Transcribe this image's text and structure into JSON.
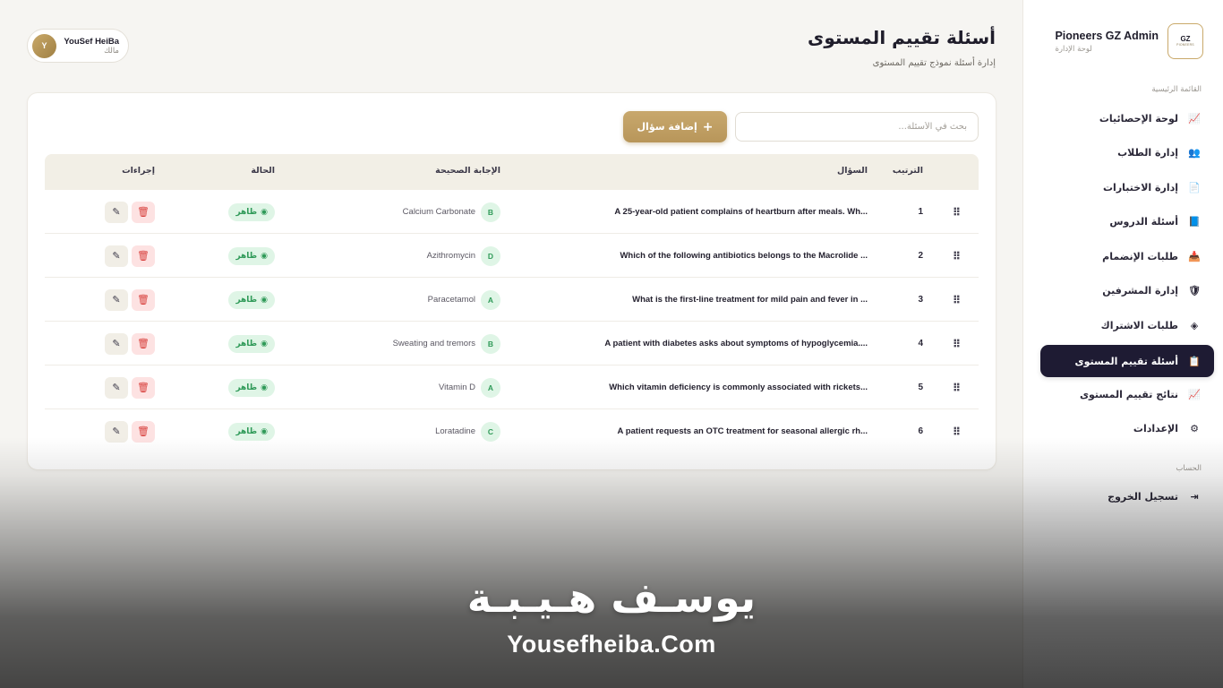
{
  "brand": {
    "title": "Pioneers GZ Admin",
    "subtitle": "لوحة الإدارة",
    "logo_main": "GZ",
    "logo_sub": "PIONEERS"
  },
  "sidebar": {
    "section_main": "القائمة الرئيسية",
    "section_account": "الحساب",
    "items": [
      {
        "label": "لوحة الإحصائيات",
        "icon": "chart-line-icon",
        "glyph": "📈"
      },
      {
        "label": "إدارة الطلاب",
        "icon": "users-icon",
        "glyph": "👥"
      },
      {
        "label": "إدارة الاختبارات",
        "icon": "file-icon",
        "glyph": "📄"
      },
      {
        "label": "أسئلة الدروس",
        "icon": "book-icon",
        "glyph": "📘"
      },
      {
        "label": "طلبات الإنضمام",
        "icon": "inbox-icon",
        "glyph": "📥"
      },
      {
        "label": "إدارة المشرفين",
        "icon": "shield-icon",
        "glyph": "🛡"
      },
      {
        "label": "طلبات الاشتراك",
        "icon": "layers-icon",
        "glyph": "◈"
      },
      {
        "label": "أسئلة تقييم المستوى",
        "icon": "clipboard-question-icon",
        "glyph": "📋",
        "active": true
      },
      {
        "label": "نتائج تقييم المستوى",
        "icon": "chart-line-icon",
        "glyph": "📈"
      },
      {
        "label": "الإعدادات",
        "icon": "gear-icon",
        "glyph": "⚙"
      }
    ],
    "logout": {
      "label": "تسجيل الخروج",
      "icon": "logout-icon",
      "glyph": "⇥"
    }
  },
  "header": {
    "title": "أسئلة تقييم المستوى",
    "subtitle": "إدارة أسئلة نموذج تقييم المستوى"
  },
  "user": {
    "name": "YouSef HeiBa",
    "role": "مالك",
    "initial": "Y"
  },
  "toolbar": {
    "search_placeholder": "بحث في الأسئلة...",
    "add_label": "إضافة سؤال",
    "add_glyph": "+"
  },
  "table": {
    "headers": {
      "order": "الترتيب",
      "question": "السؤال",
      "answer": "الإجابة الصحيحة",
      "status": "الحالة",
      "actions": "إجراءات"
    },
    "rows": [
      {
        "order": "1",
        "question": "A 25-year-old patient complains of heartburn after meals. Wh...",
        "letter": "B",
        "answer": "Calcium Carbonate",
        "status": "ظاهر"
      },
      {
        "order": "2",
        "question": "Which of the following antibiotics belongs to the Macrolide ...",
        "letter": "D",
        "answer": "Azithromycin",
        "status": "ظاهر"
      },
      {
        "order": "3",
        "question": "What is the first-line treatment for mild pain and fever in ...",
        "letter": "A",
        "answer": "Paracetamol",
        "status": "ظاهر"
      },
      {
        "order": "4",
        "question": "A patient with diabetes asks about symptoms of hypoglycemia....",
        "letter": "B",
        "answer": "Sweating and tremors",
        "status": "ظاهر"
      },
      {
        "order": "5",
        "question": "Which vitamin deficiency is commonly associated with rickets...",
        "letter": "A",
        "answer": "Vitamin D",
        "status": "ظاهر"
      },
      {
        "order": "6",
        "question": "A patient requests an OTC treatment for seasonal allergic rh...",
        "letter": "C",
        "answer": "Loratadine",
        "status": "ظاهر"
      }
    ]
  },
  "watermark": {
    "arabic": "يوسـف هـيـبـة",
    "english": "Yousefheiba.Com"
  },
  "colors": {
    "accent": "#c9a96a",
    "nav_active": "#1e1b33",
    "success": "#2f9a58",
    "danger": "#d8403c"
  }
}
